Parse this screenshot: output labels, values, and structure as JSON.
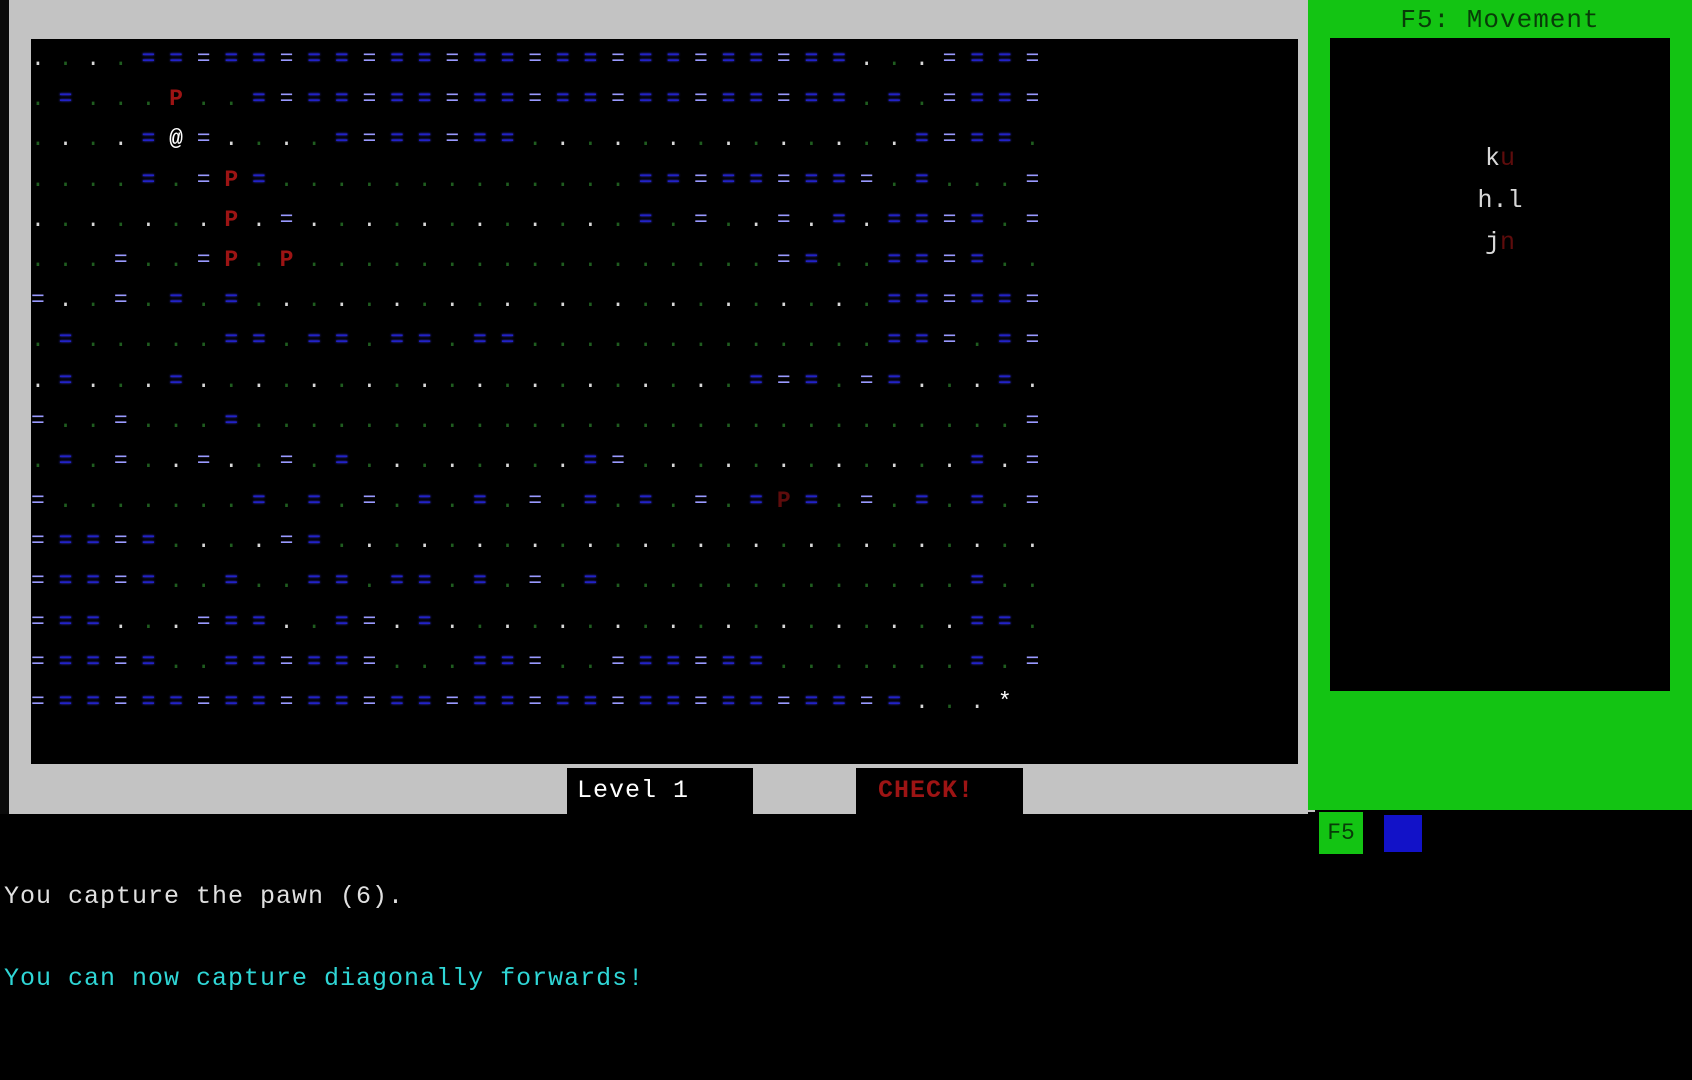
{
  "window": {
    "frame_color": "#c3c3c3",
    "background": "#000000"
  },
  "status_bar": {
    "level_label": "Level 1",
    "check_label": "CHECK!",
    "check_color": "#9d1414",
    "level_color": "#ffffff"
  },
  "side_panel": {
    "title": "F5: Movement",
    "title_color": "#083c08",
    "panel_color": "#13c413",
    "movement_rows": [
      {
        "pre": "",
        "white": "k",
        "red": "u",
        "post": ""
      },
      {
        "pre": "",
        "white": "h.l",
        "red": "",
        "post": ""
      },
      {
        "pre": "",
        "white": "j",
        "red": "n",
        "post": ""
      }
    ],
    "f5_key_label": "F5",
    "swatch_color": "#1212c8"
  },
  "messages": [
    {
      "text": "You capture the pawn (6).",
      "color": "#e0e0e0"
    },
    {
      "text": "You can now capture diagonally forwards!",
      "color": "#2fd6d6"
    }
  ],
  "map": {
    "glyph_legend": {
      "floor_dot": ".",
      "wall_equals": "=",
      "player": "@",
      "enemy_pawn": "P",
      "stairs": "*"
    },
    "colors": {
      "wall": "#2222c8",
      "floor_lit": "#d8d8d8",
      "floor_dark": "#1f5d1f",
      "pawn": "#9d1414",
      "player": "#ffffff"
    },
    "rows": [
      ". . . . = = = = = = = = = = = = = = = = = = = = = = = = = = . . . = = = =",
      ". = . . . P . . = = = = = = = = = = = = = = = = = = = = = = . = . = = = =",
      ". . . . = @ = . . . . = = = = = = = . . . . . . . . . . . . . . = = = = .",
      ". . . . = . = P = . . . . . . . . . . . . . = = = = = = = = = . = . . . =",
      ". . . . . . . P . = . . . . . . . . . . . . = . = . . = . = . = = = = . =",
      ". . . = . . = P . P . . . . . . . . . . . . . . . . . = = . . = = = = . .",
      "= . . = . = . = . . . . . . . . . . . . . . . . . . . . . . . = = = = = =",
      ". = . . . . . = = . = = . = = . = = . . . . . . . . . . . . . = = = . = =",
      ". = . . . = . . . . . . . . . . . . . . . . . . . . = = = . = = . . . = .",
      "= . . = . . . = . . . . . . . . . . . . . . . . . . . . . . . . . . . . =",
      ". = . = . . = . . = . = . . . . . . . . = = . . . . . . . . . . . . = . =",
      "= . . . . . . . = . = . = . = . = . = . = . = . = . = P = . = . = . = . =",
      "= = = = = . . . . = = . . . . . . . . . . . . . . . . . . . . . . . . . .",
      "= = = = = . . = . . = = . = = . = . = . = . . . . . . . . . . . . . = . .",
      "= = = . . . = = = . . = = . = . . . . . . . . . . . . . . . . . . . = = .",
      "= = = = = . . = = = = = = . . . = = = . . = = = = = = . . . . . . . = . =",
      "= = = = = = = = = = = = = = = = = = = = = = = = = = = = = = = = . . . *"
    ]
  }
}
